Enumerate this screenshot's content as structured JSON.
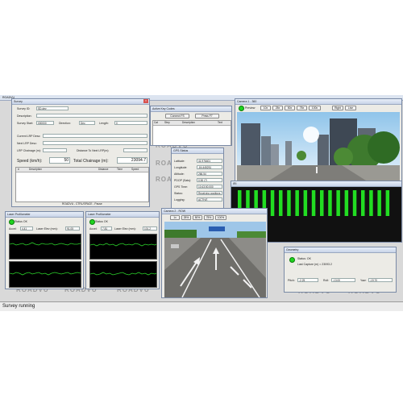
{
  "app": {
    "title": "ROADVU"
  },
  "watermark": "ROADVU",
  "survey_window": {
    "title": "Survey",
    "survey_id_label": "Survey ID:",
    "survey_id_value": "SD-dev",
    "description_label": "Description:",
    "survey_start_label": "Survey Start:",
    "survey_start_value": "000000",
    "direction_label": "Direction:",
    "direction_value": "Dec",
    "length_label": "Length:",
    "length_value": "0",
    "current_lrp_label": "Current LRP Desc:",
    "next_lrp_label": "Next LRP Desc:",
    "lrp_chainage_label": "LRP Chainage (m):",
    "distance_label": "Distance To Next LRP(m):",
    "speed_label": "Speed (km/h):",
    "speed_value": "50",
    "chainage_label": "Total Chainage (m):",
    "chainage_value": "23094.7",
    "table_headers": [
      "#",
      "Description",
      "Distance",
      "Time",
      "Speed"
    ],
    "hint": "ROADVU - CTRL/SPACE - Pause"
  },
  "event_window": {
    "title": "Active Key Codes",
    "btn_connect": "Connect FS",
    "btn_press": "Press F7",
    "headers": [
      "Cat",
      "Step",
      "Description",
      "Text"
    ]
  },
  "gps_window": {
    "title": "GPS Status",
    "rows": [
      {
        "label": "Latitude:",
        "value": "41.976401"
      },
      {
        "label": "Longitude:",
        "value": "-84.445251"
      },
      {
        "label": "Altitude:",
        "value": "266.54"
      },
      {
        "label": "PDOP (Sats):",
        "value": "0.90 (7)"
      },
      {
        "label": "GPS Time:",
        "value": "10:43:00.000"
      },
      {
        "label": "Status:",
        "value": "Receiving positions"
      },
      {
        "label": "Logging:",
        "value": "ACTIVE"
      }
    ]
  },
  "camera1": {
    "title": "Camera 1 - 360",
    "preview": "Preview",
    "zooms": [
      "10x",
      "25x",
      "50x",
      "75x",
      "100x"
    ],
    "right": "Right",
    "live": "Live"
  },
  "profiler_bars": {
    "title": "IRI",
    "count": 19,
    "color": "#22dd22"
  },
  "laser1": {
    "title": "Laser Profilometer",
    "status": "Status OK",
    "accel_label": "Accel:",
    "accel_value": "4.41",
    "laser_label": "Laser Elev (mm):",
    "laser_value": "91.05"
  },
  "laser2": {
    "title": "Laser Profilometer",
    "status": "Status OK",
    "accel_label": "Accel:",
    "accel_value": "7.81",
    "laser_label": "Laser Elev (mm):",
    "laser_value": "101.2"
  },
  "camera2": {
    "title": "Camera 2 - ROW",
    "zooms": [
      "1x",
      "25%",
      "50%",
      "75%",
      "100%"
    ]
  },
  "geometry": {
    "title": "Geometry",
    "status": "Status: OK",
    "capture": "Last Capture (m) = 23093.2",
    "pitch_label": "Pitch:",
    "pitch_value": "-2.25",
    "roll_label": "Roll:",
    "roll_value": "-13.00",
    "yaw_label": "Yaw:",
    "yaw_value": "-19.70"
  },
  "status_bar": {
    "text": "Survey running"
  },
  "colors": {
    "ok_green": "#1fd41f",
    "bar_green": "#22dd22",
    "plot_bg": "#000000",
    "trace_green": "#2bd12b"
  }
}
